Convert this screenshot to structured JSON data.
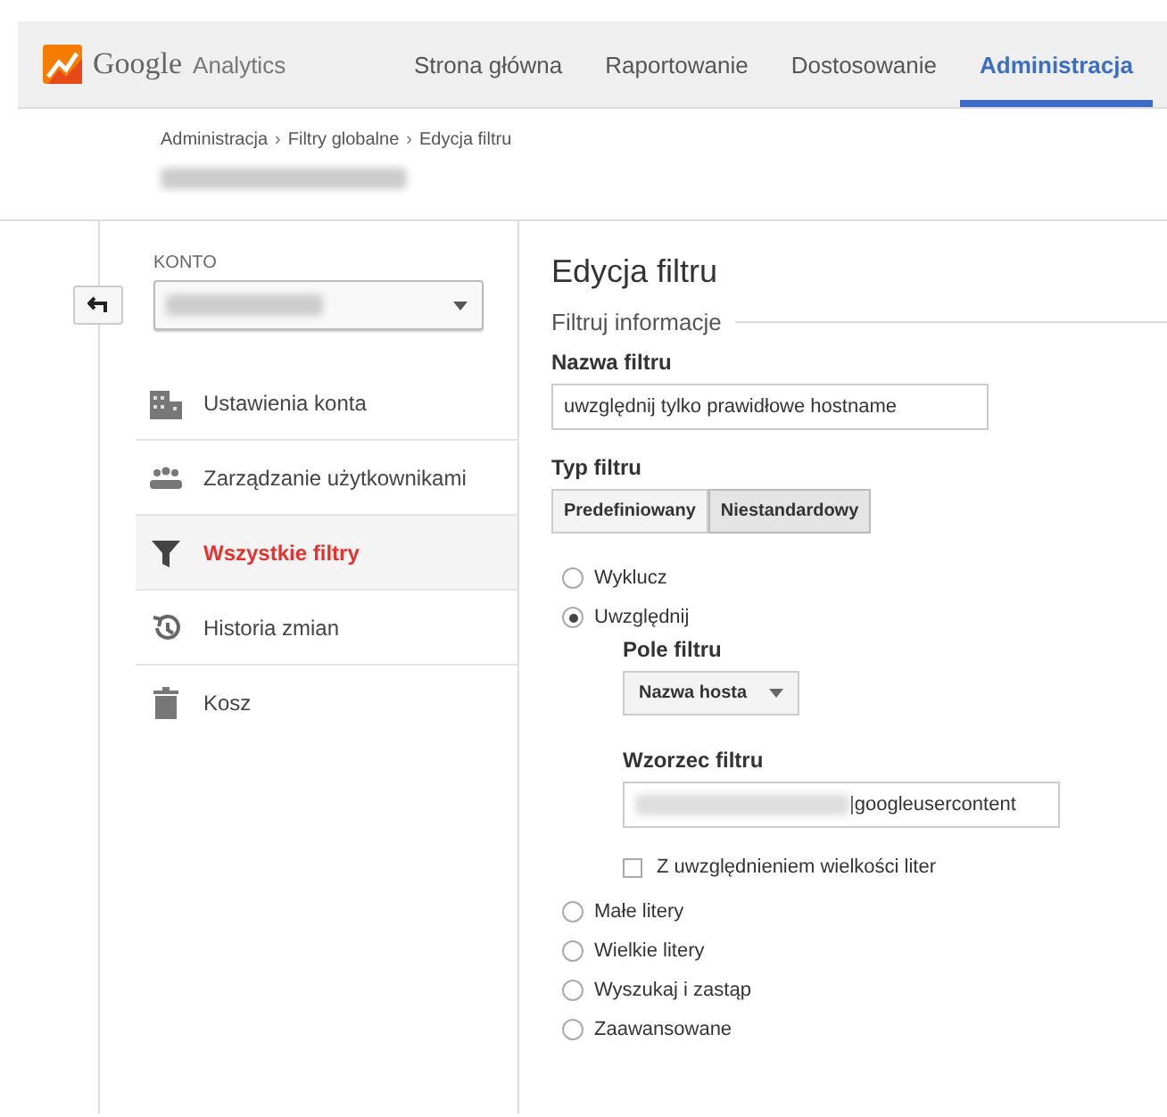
{
  "header": {
    "logo": {
      "brand": "Google",
      "product": "Analytics"
    },
    "tabs": [
      {
        "label": "Strona główna",
        "selected": false
      },
      {
        "label": "Raportowanie",
        "selected": false
      },
      {
        "label": "Dostosowanie",
        "selected": false
      },
      {
        "label": "Administracja",
        "selected": true
      }
    ]
  },
  "breadcrumb": [
    {
      "kind": "link",
      "text": "Administracja"
    },
    {
      "kind": "separator",
      "text": "›"
    },
    {
      "kind": "link",
      "text": "Filtry globalne"
    },
    {
      "kind": "separator",
      "text": "›"
    },
    {
      "kind": "current",
      "text": "Edycja filtru"
    }
  ],
  "sidebar": {
    "account_label": "KONTO",
    "items": [
      {
        "label": "Ustawienia konta",
        "selected": false
      },
      {
        "label": "Zarządzanie użytkownikami",
        "selected": false
      },
      {
        "label": "Wszystkie filtry",
        "selected": true
      },
      {
        "label": "Historia zmian",
        "selected": false
      },
      {
        "label": "Kosz",
        "selected": false
      }
    ]
  },
  "form": {
    "title": "Edycja filtru",
    "section": "Filtruj informacje",
    "name_label": "Nazwa filtru",
    "name_value": "uwzględnij tylko prawidłowe hostname",
    "type_label": "Typ filtru",
    "type_options": [
      {
        "label": "Predefiniowany",
        "selected": false
      },
      {
        "label": "Niestandardowy",
        "selected": true
      }
    ],
    "options": [
      {
        "label": "Wyklucz",
        "selected": false
      },
      {
        "label": "Uwzględnij",
        "selected": true,
        "details": {
          "field_label": "Pole filtru",
          "field_value": "Nazwa hosta",
          "pattern_label": "Wzorzec filtru",
          "pattern_value": "|googleusercontent",
          "case_label": "Z uwzględnieniem wielkości liter",
          "case_checked": false
        }
      },
      {
        "label": "Małe litery",
        "selected": false
      },
      {
        "label": "Wielkie litery",
        "selected": false
      },
      {
        "label": "Wyszukaj i zastąp",
        "selected": false
      },
      {
        "label": "Zaawansowane",
        "selected": false
      }
    ]
  }
}
